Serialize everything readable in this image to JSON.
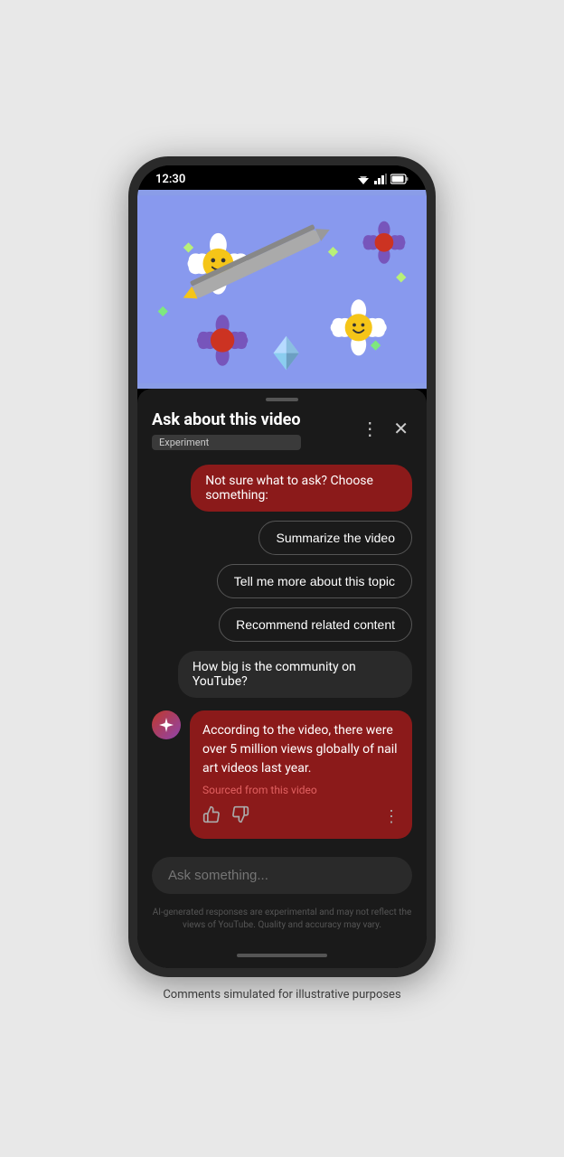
{
  "status_bar": {
    "time": "12:30"
  },
  "header": {
    "title": "Ask about this video",
    "badge": "Experiment"
  },
  "chat": {
    "system_prompt": "Not sure what to ask? Choose something:",
    "suggestions": [
      "Summarize the video",
      "Tell me more about this topic",
      "Recommend related content"
    ],
    "user_question": "How big is the community on YouTube?",
    "ai_response": "According to the video, there were over 5 million views globally of nail art videos last year.",
    "ai_source": "Sourced from this video"
  },
  "input": {
    "placeholder": "Ask something..."
  },
  "disclaimer": "AI-generated responses are experimental and may not reflect the views of YouTube. Quality and accuracy may vary.",
  "caption": "Comments simulated for illustrative purposes",
  "icons": {
    "more_vert": "⋮",
    "close": "✕",
    "thumbup": "👍",
    "thumbdown": "👎",
    "sparkle": "✦"
  }
}
